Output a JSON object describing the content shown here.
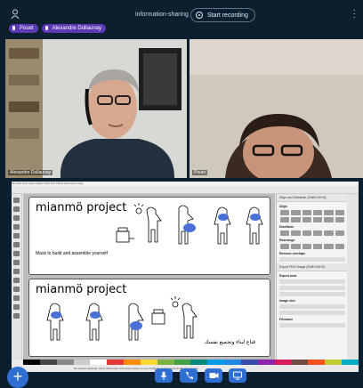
{
  "header": {
    "room_title": "information-sharing",
    "record_label": "Start recording"
  },
  "participants_bar": [
    {
      "name": "Pouet"
    },
    {
      "name": "Alexandre Dullaunay"
    }
  ],
  "tiles": [
    {
      "name": "Alexandre Dullaunay"
    },
    {
      "name": "Pouet"
    }
  ],
  "shared_screen": {
    "app": "Inkscape",
    "menu": "File  Edit  View  Layer  Object  Path  Text  Filters  Extensions  Help",
    "pages": [
      {
        "title": "mianmö project",
        "caption": "Mask to build and assemble yourself"
      },
      {
        "title": "mianmö project",
        "caption": "قناع لبناء وتجميع نفسك"
      }
    ],
    "panel": {
      "header": "Align and Distribute (Shift+Ctrl+A)",
      "sections": [
        "Align",
        "Distribute",
        "Rearrange",
        "Remove overlaps"
      ],
      "export_header": "Export PNG Image (Shift+Ctrl+E)",
      "export_sections": [
        "Export area",
        "Image size",
        "Filename"
      ],
      "export_tabs": [
        "Page",
        "Drawing",
        "Selection",
        "Custom"
      ]
    },
    "status": "No objects selected. Click, Shift+click, Alt+scroll mouse on top of objects, or drag around objects to select."
  },
  "colors": {
    "background": "#0b1f2e",
    "accent": "#2f6fd1",
    "pill": "#5b3bb3",
    "mask_blue": "#4a6fd8"
  },
  "controls": [
    "plus-icon",
    "microphone-icon",
    "phone-icon",
    "camera-icon",
    "screen-share-icon"
  ]
}
